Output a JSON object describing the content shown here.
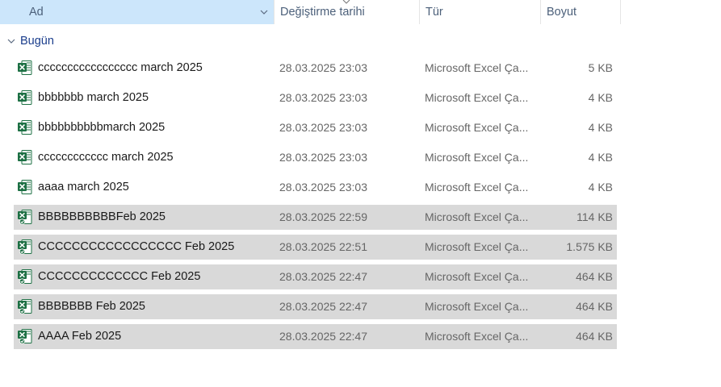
{
  "columns": {
    "name": "Ad",
    "date": "Değiştirme tarihi",
    "type": "Tür",
    "size": "Boyut"
  },
  "group": {
    "label": "Bugün"
  },
  "files": [
    {
      "name": "ccccccccccccccccc march 2025",
      "date": "28.03.2025 23:03",
      "type": "Microsoft Excel Ça...",
      "size": "5 KB",
      "selected": false,
      "icon": "excel-icon"
    },
    {
      "name": "bbbbbbb march 2025",
      "date": "28.03.2025 23:03",
      "type": "Microsoft Excel Ça...",
      "size": "4 KB",
      "selected": false,
      "icon": "excel-icon"
    },
    {
      "name": "bbbbbbbbbbmarch 2025",
      "date": "28.03.2025 23:03",
      "type": "Microsoft Excel Ça...",
      "size": "4 KB",
      "selected": false,
      "icon": "excel-icon"
    },
    {
      "name": "cccccccccccc march 2025",
      "date": "28.03.2025 23:03",
      "type": "Microsoft Excel Ça...",
      "size": "4 KB",
      "selected": false,
      "icon": "excel-icon"
    },
    {
      "name": "aaaa march 2025",
      "date": "28.03.2025 23:03",
      "type": "Microsoft Excel Ça...",
      "size": "4 KB",
      "selected": false,
      "icon": "excel-icon"
    },
    {
      "name": "BBBBBBBBBBFeb 2025",
      "date": "28.03.2025 22:59",
      "type": "Microsoft Excel Ça...",
      "size": "114 KB",
      "selected": true,
      "icon": "excel-shared-icon"
    },
    {
      "name": "CCCCCCCCCCCCCCCCC Feb 2025",
      "date": "28.03.2025 22:51",
      "type": "Microsoft Excel Ça...",
      "size": "1.575 KB",
      "selected": true,
      "icon": "excel-shared-icon"
    },
    {
      "name": "CCCCCCCCCCCCC Feb 2025",
      "date": "28.03.2025 22:47",
      "type": "Microsoft Excel Ça...",
      "size": "464 KB",
      "selected": true,
      "icon": "excel-shared-icon"
    },
    {
      "name": "BBBBBBB Feb 2025",
      "date": "28.03.2025 22:47",
      "type": "Microsoft Excel Ça...",
      "size": "464 KB",
      "selected": true,
      "icon": "excel-shared-icon"
    },
    {
      "name": "AAAA Feb 2025",
      "date": "28.03.2025 22:47",
      "type": "Microsoft Excel Ça...",
      "size": "464 KB",
      "selected": true,
      "icon": "excel-shared-icon"
    }
  ],
  "colors": {
    "header_bg": "#cce6fb",
    "selected_row_bg": "#d9d9d9",
    "excel_green": "#1d7044",
    "group_label": "#1a3d8c"
  }
}
